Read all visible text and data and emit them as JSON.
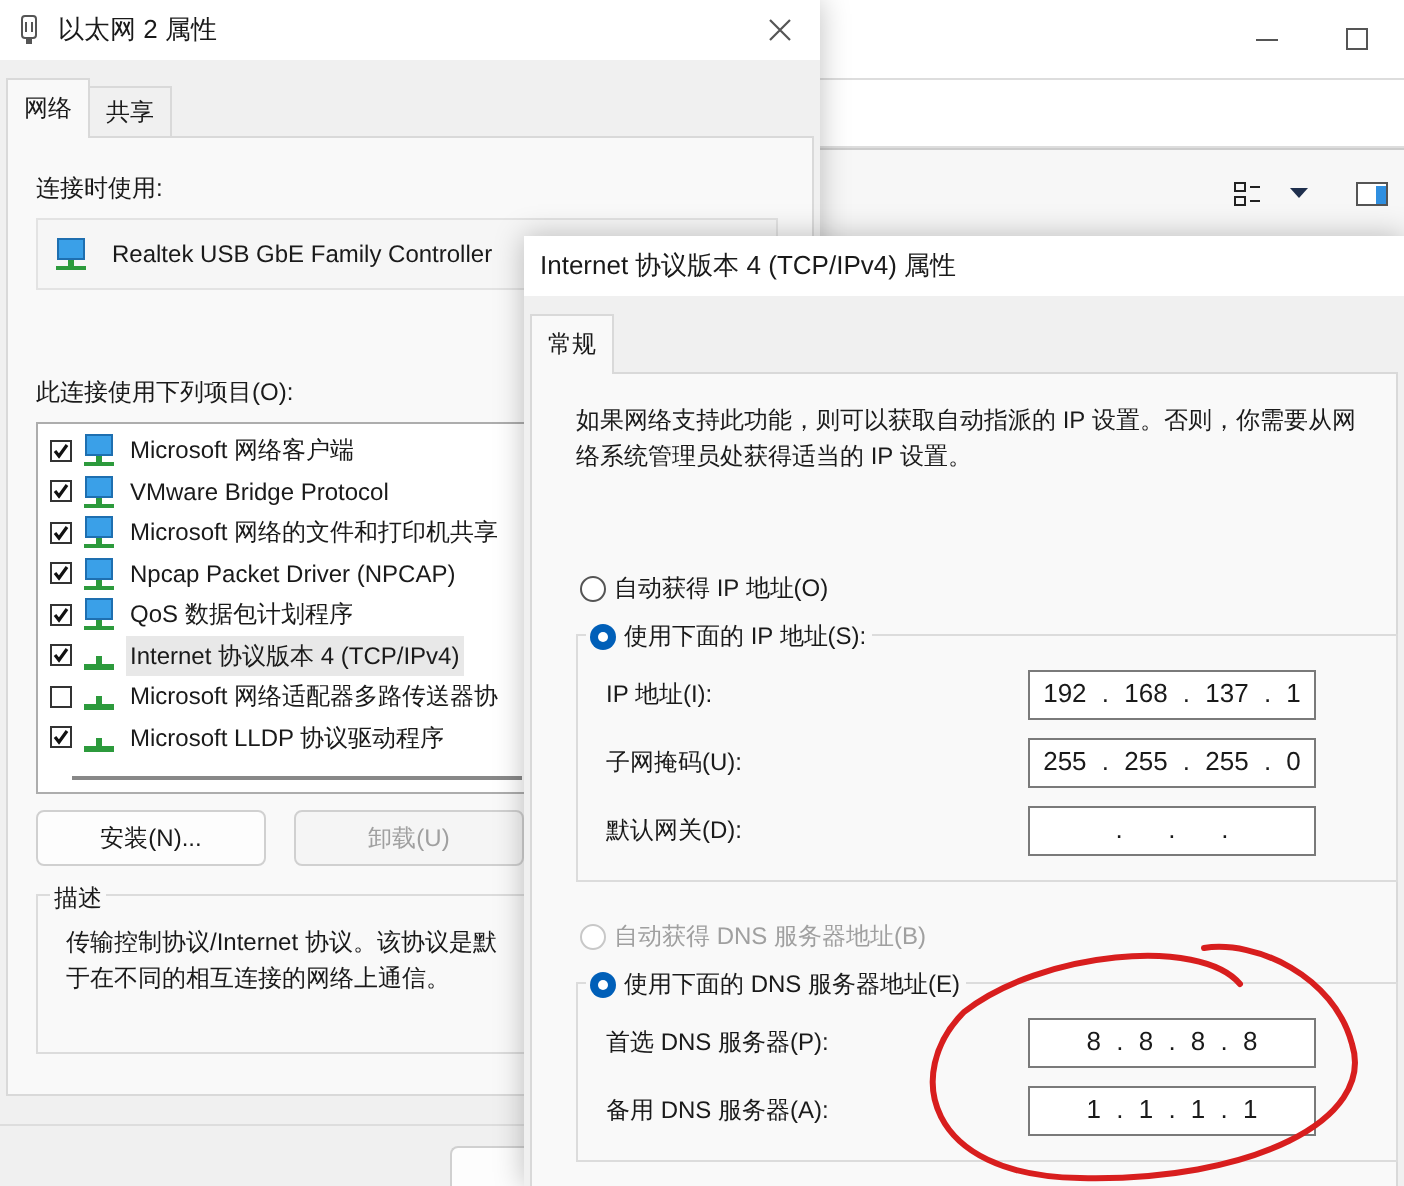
{
  "adapter_dialog": {
    "title": "以太网 2 属性",
    "tabs": [
      {
        "label": "网络",
        "selected": true
      },
      {
        "label": "共享",
        "selected": false
      }
    ],
    "connect_using_label": "连接时使用:",
    "adapter": "Realtek USB GbE Family Controller",
    "items_label": "此连接使用下列项目(O):",
    "items": [
      {
        "label": "Microsoft 网络客户端",
        "kind": "service",
        "checked": true,
        "selected": false
      },
      {
        "label": "VMware Bridge Protocol",
        "kind": "service",
        "checked": true,
        "selected": false
      },
      {
        "label": "Microsoft 网络的文件和打印机共享",
        "kind": "service",
        "checked": true,
        "selected": false
      },
      {
        "label": "Npcap Packet Driver (NPCAP)",
        "kind": "service",
        "checked": true,
        "selected": false
      },
      {
        "label": "QoS 数据包计划程序",
        "kind": "service",
        "checked": true,
        "selected": false
      },
      {
        "label": "Internet 协议版本 4 (TCP/IPv4)",
        "kind": "protocol",
        "checked": true,
        "selected": true
      },
      {
        "label": "Microsoft 网络适配器多路传送器协",
        "kind": "protocol",
        "checked": false,
        "selected": false
      },
      {
        "label": "Microsoft LLDP 协议驱动程序",
        "kind": "protocol",
        "checked": true,
        "selected": false
      }
    ],
    "buttons": [
      {
        "label": "安装(N)...",
        "disabled": false
      },
      {
        "label": "卸载(U)",
        "disabled": true
      }
    ],
    "description": {
      "legend": "描述",
      "lines": [
        "传输控制协议/Internet 协议。该协议是默",
        "于在不同的相互连接的网络上通信。"
      ]
    }
  },
  "ipv4_dialog": {
    "title": "Internet 协议版本 4 (TCP/IPv4) 属性",
    "tabs": [
      {
        "label": "常规",
        "selected": true
      }
    ],
    "intro": "如果网络支持此功能，则可以获取自动指派的 IP 设置。否则，你需要从网络系统管理员处获得适当的 IP 设置。",
    "ip_mode": [
      {
        "label": "自动获得 IP 地址(O)",
        "selected": false,
        "disabled": false
      },
      {
        "label": "使用下面的 IP 地址(S):",
        "selected": true
      }
    ],
    "ip_fields": [
      {
        "label": "IP 地址(I):",
        "value": "192 . 168 . 137 . 1"
      },
      {
        "label": "子网掩码(U):",
        "value": "255 . 255 . 255 . 0"
      },
      {
        "label": "默认网关(D):",
        "value": ".   .   ."
      }
    ],
    "dns_mode": [
      {
        "label": "自动获得 DNS 服务器地址(B)",
        "selected": false,
        "disabled": true
      },
      {
        "label": "使用下面的 DNS 服务器地址(E)",
        "selected": true
      }
    ],
    "dns_fields": [
      {
        "label": "首选 DNS 服务器(P):",
        "value": "8 . 8 . 8 . 8"
      },
      {
        "label": "备用 DNS 服务器(A):",
        "value": "1 . 1 . 1 . 1"
      }
    ]
  }
}
